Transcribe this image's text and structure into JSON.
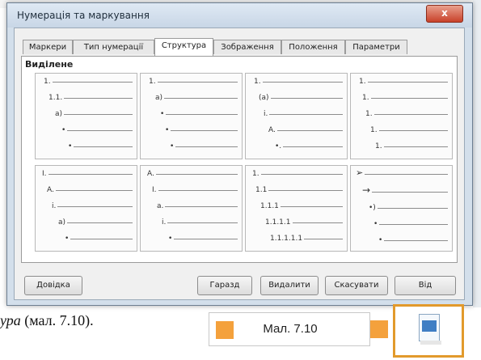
{
  "dialog": {
    "title": "Нумерація та маркування",
    "close_label": "x",
    "tabs": [
      "Маркери",
      "Тип нумерації",
      "Структура",
      "Зображення",
      "Положення",
      "Параметри"
    ],
    "active_tab": "Структура",
    "section_label": "Виділене",
    "presets": [
      {
        "labels": [
          "1.",
          "1.1.",
          "a)",
          "•",
          "•"
        ]
      },
      {
        "labels": [
          "1.",
          "a)",
          "•",
          "•",
          "•"
        ]
      },
      {
        "labels": [
          "1.",
          "(a)",
          "i.",
          "A.",
          "•."
        ]
      },
      {
        "labels": [
          "1.",
          "1.",
          "1.",
          "1.",
          "1."
        ]
      },
      {
        "labels": [
          "I.",
          "A.",
          "i.",
          "a)",
          "•"
        ]
      },
      {
        "labels": [
          "A.",
          "I.",
          "a.",
          "i.",
          "•"
        ]
      },
      {
        "labels": [
          "1.",
          "1.1",
          "1.1.1",
          "1.1.1.1",
          "1.1.1.1.1"
        ]
      },
      {
        "labels": [
          "➢",
          "→",
          "•)",
          "•",
          "•"
        ]
      }
    ],
    "buttons": {
      "help": "Довідка",
      "ok": "Гаразд",
      "delete": "Видалити",
      "cancel": "Скасувати",
      "reset": "Від"
    }
  },
  "page": {
    "text_italic": "ура",
    "text_rest": " (мал. 7.10).",
    "caption": "Мал. 7.10"
  },
  "colors": {
    "accent_orange": "#f4a13c",
    "close_red": "#c8412a"
  }
}
